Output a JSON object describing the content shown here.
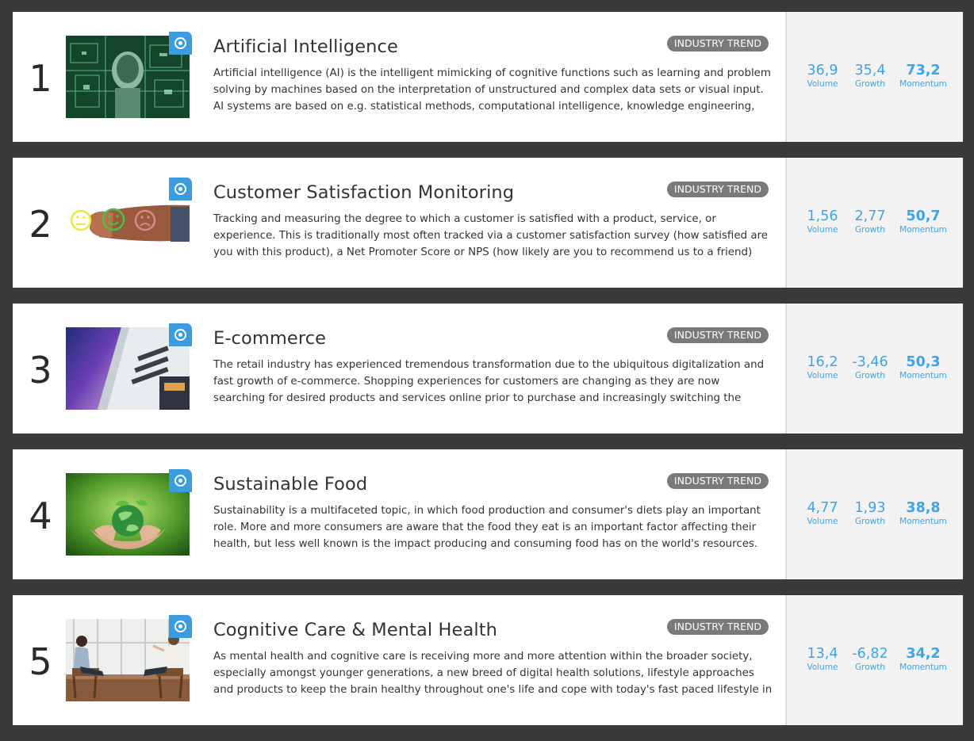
{
  "trends": [
    {
      "rank": "1",
      "title": "Artificial Intelligence",
      "badge": "INDUSTRY TREND",
      "description": "Artificial intelligence (AI) is the intelligent mimicking of cognitive functions such as learning and problem solving by machines based on the interpretation of unstructured and complex data sets or visual input. AI systems are based on e.g. statistical methods, computational intelligence, knowledge engineering, predictive...",
      "volume": "36,9",
      "growth": "35,4",
      "momentum": "73,2",
      "volume_label": "Volume",
      "growth_label": "Growth",
      "momentum_label": "Momentum",
      "image": "ai-image",
      "track_icon": "target-icon"
    },
    {
      "rank": "2",
      "title": "Customer Satisfaction Monitoring",
      "badge": "INDUSTRY TREND",
      "description": "Tracking and measuring the degree to which a customer is satisfied with a product, service, or experience. This is traditionally most often tracked via a customer satisfaction survey (how satisfied are you with this product), a Net Promoter Score or NPS (how likely are you to recommend us to a friend) and consumer product...",
      "volume": "1,56",
      "growth": "2,77",
      "momentum": "50,7",
      "volume_label": "Volume",
      "growth_label": "Growth",
      "momentum_label": "Momentum",
      "image": "satisfaction-image",
      "track_icon": "target-icon"
    },
    {
      "rank": "3",
      "title": "E-commerce",
      "badge": "INDUSTRY TREND",
      "description": "The retail industry has experienced tremendous transformation due to the ubiquitous digitalization and fast growth of e-commerce. Shopping experiences for customers are changing as they are now searching for desired products and services online prior to purchase and increasingly switching the purchase to online...",
      "volume": "16,2",
      "growth": "-3,46",
      "momentum": "50,3",
      "volume_label": "Volume",
      "growth_label": "Growth",
      "momentum_label": "Momentum",
      "image": "ecommerce-image",
      "track_icon": "target-icon"
    },
    {
      "rank": "4",
      "title": "Sustainable Food",
      "badge": "INDUSTRY TREND",
      "description": "Sustainability is a multifaceted topic, in which food production and consumer's diets play an important role. More and more consumers are aware that the food they eat is an important factor affecting their health, but less well known is the impact producing and consuming food has on the world's resources. Therefore...",
      "volume": "4,77",
      "growth": "1,93",
      "momentum": "38,8",
      "volume_label": "Volume",
      "growth_label": "Growth",
      "momentum_label": "Momentum",
      "image": "sustainable-food-image",
      "track_icon": "target-icon"
    },
    {
      "rank": "5",
      "title": "Cognitive Care & Mental Health",
      "badge": "INDUSTRY TREND",
      "description": "As mental health and cognitive care is receiving more and more attention within the broader society, especially amongst younger generations, a new breed of digital health solutions, lifestyle approaches and products to keep the brain healthy throughout one's life and cope with today's fast paced lifestyle in order...",
      "volume": "13,4",
      "growth": "-6,82",
      "momentum": "34,2",
      "volume_label": "Volume",
      "growth_label": "Growth",
      "momentum_label": "Momentum",
      "image": "mental-health-image",
      "track_icon": "target-icon"
    }
  ],
  "colors": {
    "background": "#3a3a3a",
    "card": "#ffffff",
    "stats_panel": "#f2f2f2",
    "accent": "#3ea3e8",
    "badge": "#7a7a7a",
    "text": "#333333"
  }
}
